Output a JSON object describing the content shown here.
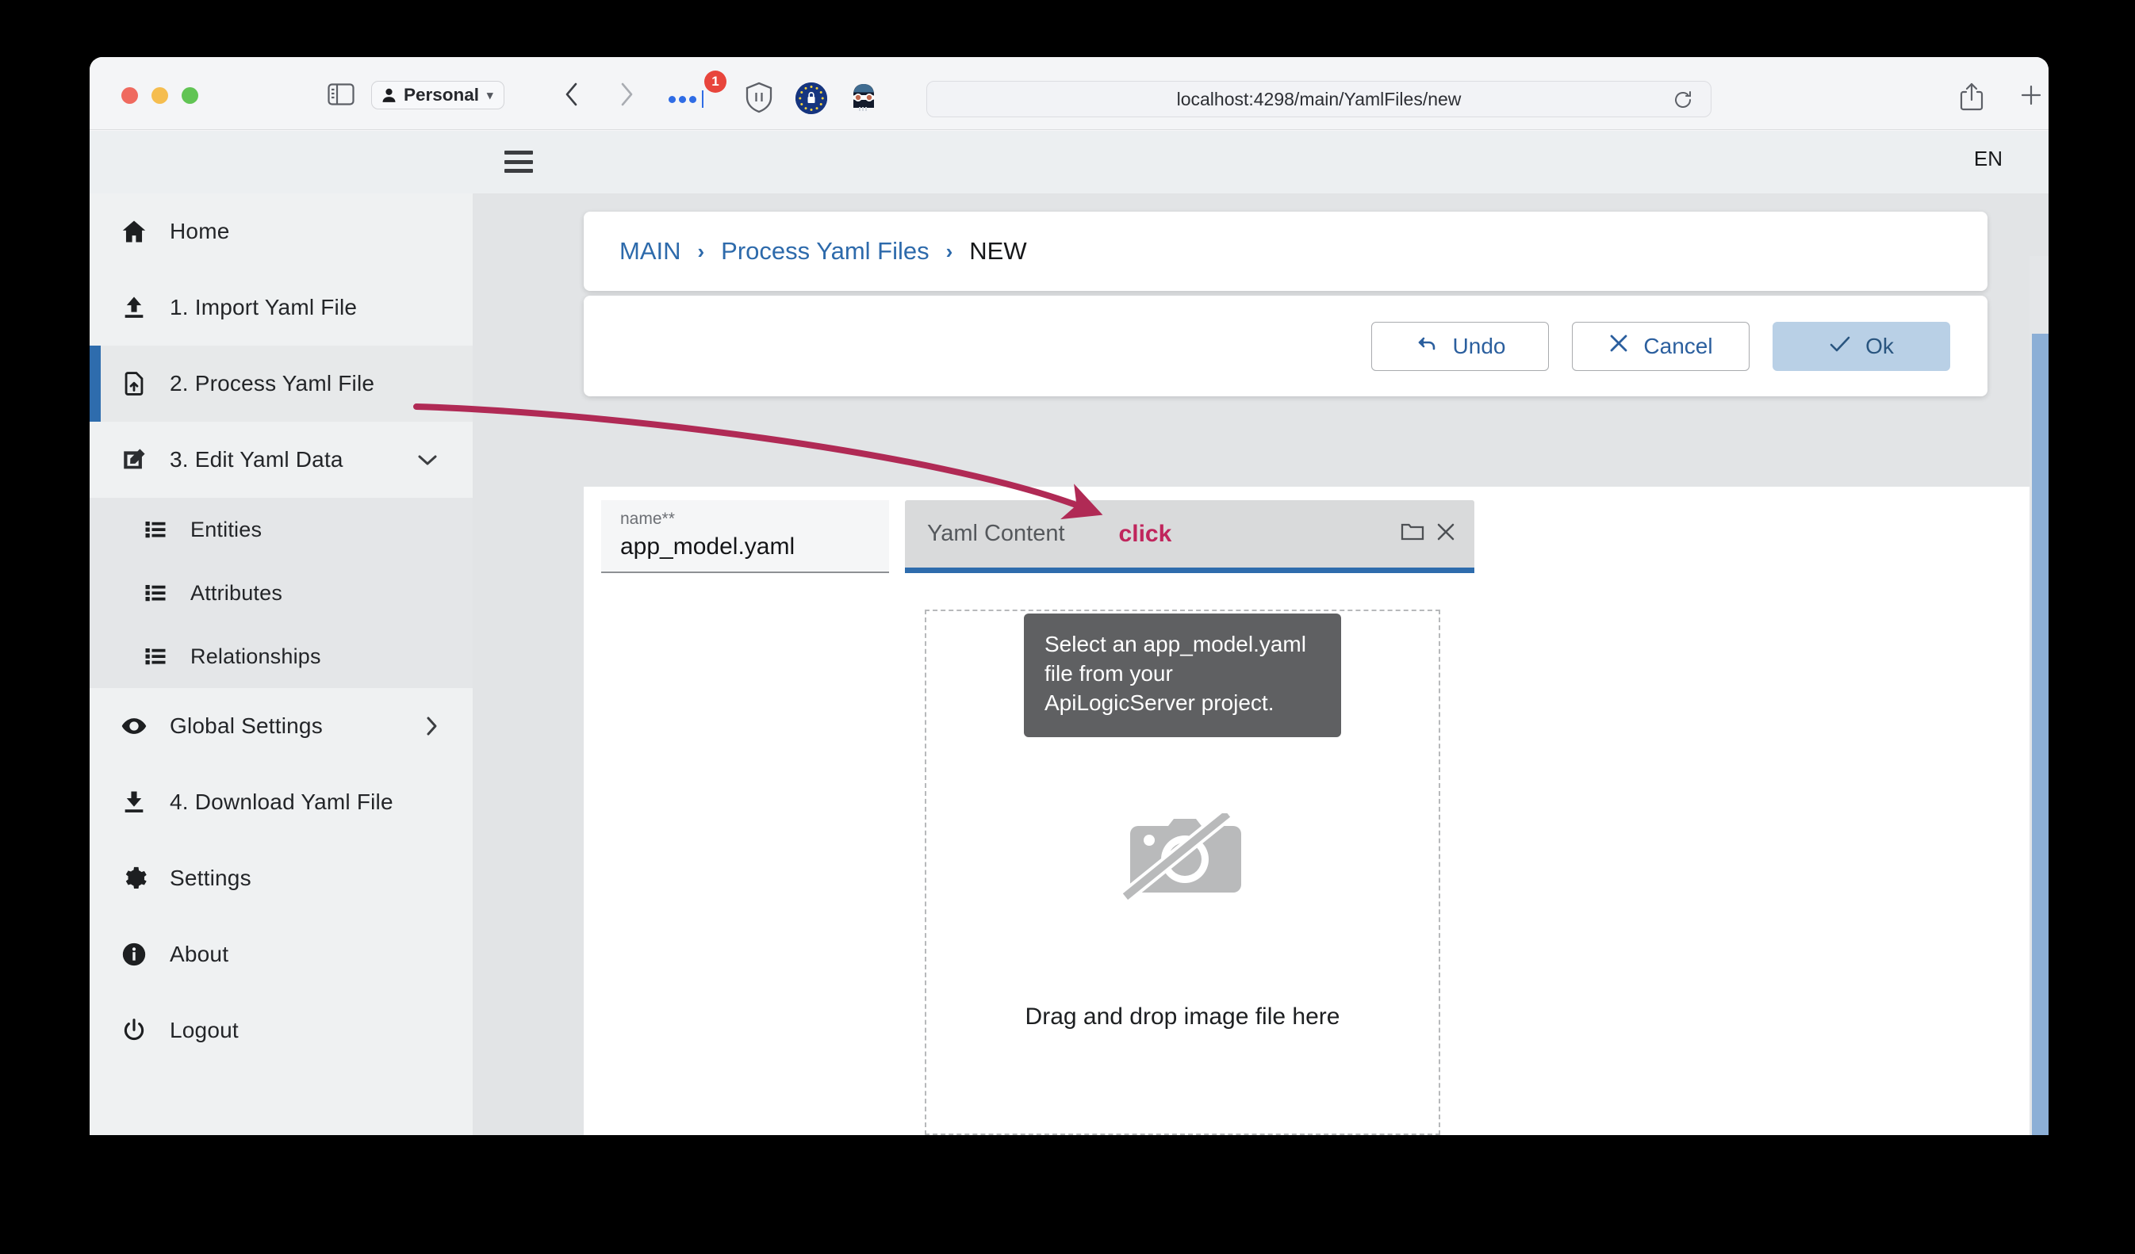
{
  "browser": {
    "profile_label": "Personal",
    "extension_badge_count": "1",
    "url": "localhost:4298/main/YamlFiles/new",
    "icons": {
      "sidebar_toggle": "sidebar-toggle-icon",
      "back": "back-arrow-icon",
      "forward": "forward-arrow-icon",
      "extensions_more": "extensions-more-icon",
      "shield": "shield-pause-icon",
      "eu_privacy": "eu-lock-icon",
      "avatar_extension": "avatar-extension-icon",
      "reload": "reload-icon",
      "share": "share-icon",
      "new_tab": "plus-icon",
      "tab_overview": "tab-overview-icon"
    }
  },
  "app": {
    "header": {
      "menu_icon": "hamburger-icon",
      "language": "EN"
    },
    "sidebar": {
      "items": [
        {
          "label": "Home",
          "icon": "home-icon",
          "active": false
        },
        {
          "label": "1. Import Yaml File",
          "icon": "upload-icon",
          "active": false
        },
        {
          "label": "2. Process Yaml File",
          "icon": "file-upload-icon",
          "active": true
        },
        {
          "label": "3. Edit Yaml Data",
          "icon": "edit-icon",
          "active": false,
          "chevron": "chevron-down-icon"
        }
      ],
      "subitems": [
        {
          "label": "Entities",
          "icon": "list-icon"
        },
        {
          "label": "Attributes",
          "icon": "list-icon"
        },
        {
          "label": "Relationships",
          "icon": "list-icon"
        }
      ],
      "items_bottom": [
        {
          "label": "Global Settings",
          "icon": "eye-icon",
          "chevron": "chevron-right-icon"
        },
        {
          "label": "4. Download Yaml File",
          "icon": "download-icon"
        },
        {
          "label": "Settings",
          "icon": "gear-icon"
        },
        {
          "label": "About",
          "icon": "info-icon"
        },
        {
          "label": "Logout",
          "icon": "power-icon"
        }
      ]
    },
    "breadcrumb": {
      "items": [
        "MAIN",
        "Process Yaml Files",
        "NEW"
      ],
      "separator": "›"
    },
    "actions": {
      "undo": "Undo",
      "cancel": "Cancel",
      "ok": "Ok"
    },
    "form": {
      "name_label": "name**",
      "name_value": "app_model.yaml"
    },
    "tab": {
      "label": "Yaml Content",
      "annotation_word": "click",
      "folder_icon": "folder-icon",
      "close_icon": "close-icon"
    },
    "dropzone": {
      "tooltip": "Select an app_model.yaml file from your ApiLogicServer project.",
      "placeholder_icon": "camera-off-icon",
      "drop_text": "Drag and drop image file here"
    }
  },
  "colors": {
    "accent_blue": "#2e6cad",
    "annotation_crimson": "#b02a55",
    "primary_button_bg": "#b9d0e6",
    "scrollbar_thumb": "#8cafd6"
  }
}
